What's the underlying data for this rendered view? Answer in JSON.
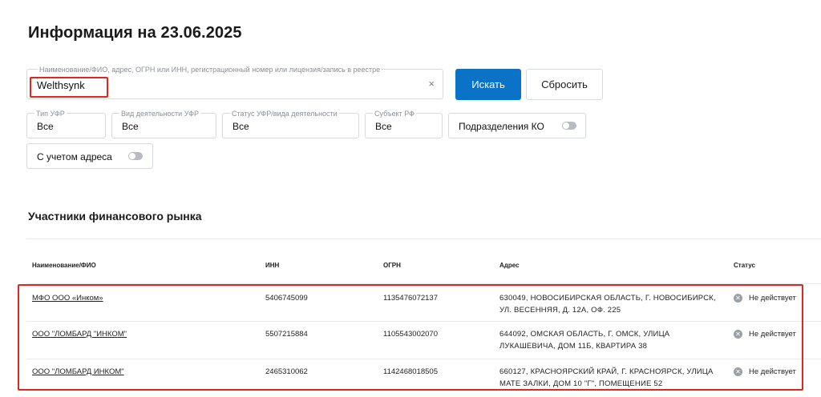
{
  "page": {
    "title": "Информация на 23.06.2025"
  },
  "search": {
    "label": "Наименование/ФИО, адрес, ОГРН или ИНН, регистрационный номер или лицензия/запись в реестре",
    "value": "Welthsynk",
    "clear_icon": "×",
    "search_button": "Искать",
    "reset_button": "Сбросить"
  },
  "filters": [
    {
      "label": "Тип УФР",
      "value": "Все"
    },
    {
      "label": "Вид деятельности УФР",
      "value": "Все"
    },
    {
      "label": "Статус УФР/вида деятельности",
      "value": "Все"
    },
    {
      "label": "Субъект РФ",
      "value": "Все"
    }
  ],
  "toggles": {
    "branches": {
      "label": "Подразделения КО",
      "on": false
    },
    "address": {
      "label": "С учетом адреса",
      "on": false
    }
  },
  "section": {
    "title": "Участники финансового рынка"
  },
  "table": {
    "headers": [
      "Наименование/ФИО",
      "ИНН",
      "ОГРН",
      "Адрес",
      "Статус"
    ],
    "rows": [
      {
        "name": "МФО ООО «Инком»",
        "inn": "5406745099",
        "ogrn": "1135476072137",
        "address": "630049, НОВОСИБИРСКАЯ ОБЛАСТЬ, Г. НОВОСИБИРСК, УЛ. ВЕСЕННЯЯ, Д. 12А, ОФ. 225",
        "status": "Не действует"
      },
      {
        "name": "ООО \"ЛОМБАРД \"ИНКОМ\"",
        "inn": "5507215884",
        "ogrn": "1105543002070",
        "address": "644092, ОМСКАЯ ОБЛАСТЬ, Г. ОМСК, УЛИЦА ЛУКАШЕВИЧА, ДОМ 11Б, КВАРТИРА 38",
        "status": "Не действует"
      },
      {
        "name": "ООО \"ЛОМБАРД ИНКОМ\"",
        "inn": "2465310062",
        "ogrn": "1142468018505",
        "address": "660127, КРАСНОЯРСКИЙ КРАЙ, Г. КРАСНОЯРСК, УЛИЦА МАТЕ ЗАЛКИ, ДОМ 10 \"Г\", ПОМЕЩЕНИЕ 52",
        "status": "Не действует"
      }
    ]
  },
  "icons": {
    "status_inactive": "x-circle-icon",
    "clear": "close-icon"
  },
  "colors": {
    "primary_button": "#0a73c8",
    "highlight": "#e0261f",
    "status_icon": "#9aa0a6"
  }
}
